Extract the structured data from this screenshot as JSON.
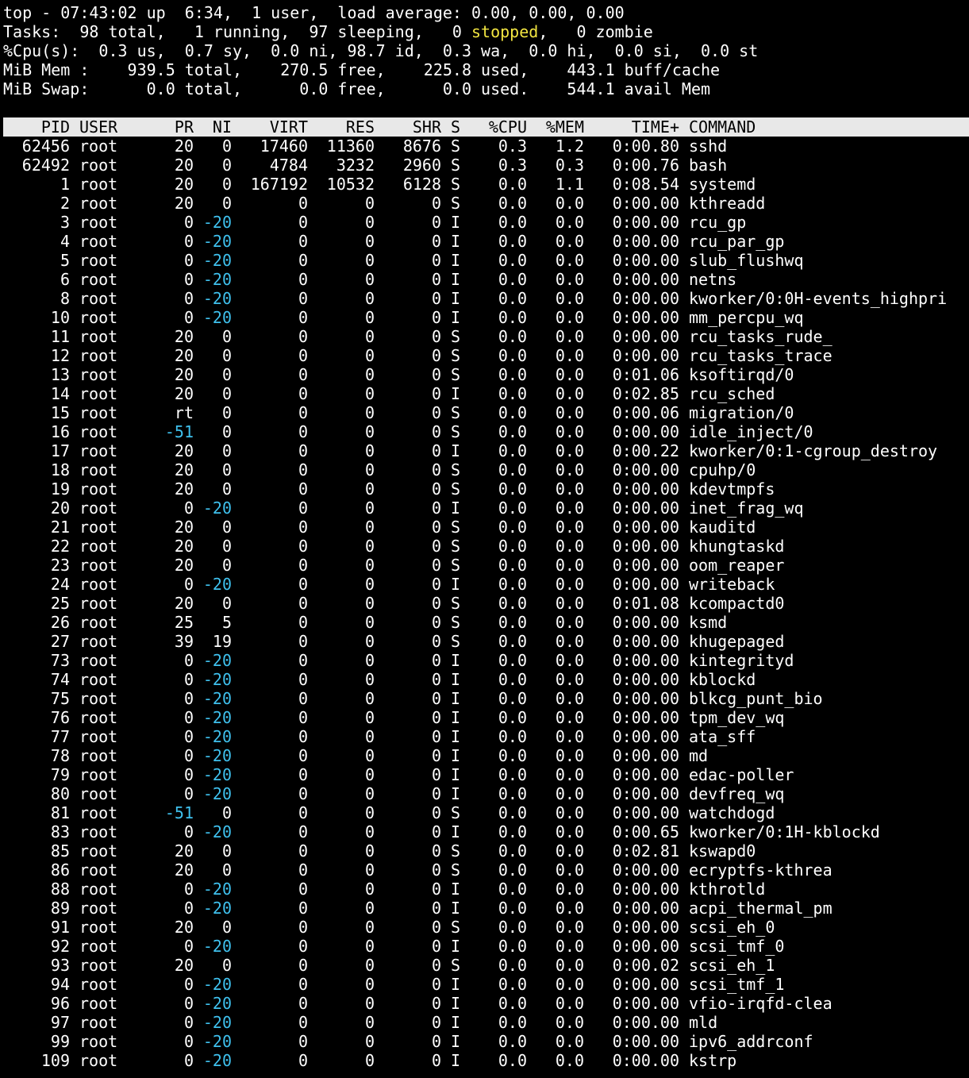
{
  "summary": {
    "line1": "top - 07:43:02 up  6:34,  1 user,  load average: 0.00, 0.00, 0.00",
    "tasks_pre": "Tasks:  98 total,   1 running,  97 sleeping,   0 ",
    "tasks_stopped": "stopped",
    "tasks_post": ",   0 zombie",
    "cpu": "%Cpu(s):  0.3 us,  0.7 sy,  0.0 ni, 98.7 id,  0.3 wa,  0.0 hi,  0.0 si,  0.0 st",
    "mem": "MiB Mem :    939.5 total,    270.5 free,    225.8 used,    443.1 buff/cache",
    "swap": "MiB Swap:      0.0 total,      0.0 free,      0.0 used.    544.1 avail Mem"
  },
  "columns": [
    "PID",
    "USER",
    "PR",
    "NI",
    "VIRT",
    "RES",
    "SHR",
    "S",
    "%CPU",
    "%MEM",
    "TIME+",
    "COMMAND"
  ],
  "processes": [
    [
      "62456",
      "root",
      "20",
      "0",
      "17460",
      "11360",
      "8676",
      "S",
      "0.3",
      "1.2",
      "0:00.80",
      "sshd"
    ],
    [
      "62492",
      "root",
      "20",
      "0",
      "4784",
      "3232",
      "2960",
      "S",
      "0.3",
      "0.3",
      "0:00.76",
      "bash"
    ],
    [
      "1",
      "root",
      "20",
      "0",
      "167192",
      "10532",
      "6128",
      "S",
      "0.0",
      "1.1",
      "0:08.54",
      "systemd"
    ],
    [
      "2",
      "root",
      "20",
      "0",
      "0",
      "0",
      "0",
      "S",
      "0.0",
      "0.0",
      "0:00.00",
      "kthreadd"
    ],
    [
      "3",
      "root",
      "0",
      "-20",
      "0",
      "0",
      "0",
      "I",
      "0.0",
      "0.0",
      "0:00.00",
      "rcu_gp"
    ],
    [
      "4",
      "root",
      "0",
      "-20",
      "0",
      "0",
      "0",
      "I",
      "0.0",
      "0.0",
      "0:00.00",
      "rcu_par_gp"
    ],
    [
      "5",
      "root",
      "0",
      "-20",
      "0",
      "0",
      "0",
      "I",
      "0.0",
      "0.0",
      "0:00.00",
      "slub_flushwq"
    ],
    [
      "6",
      "root",
      "0",
      "-20",
      "0",
      "0",
      "0",
      "I",
      "0.0",
      "0.0",
      "0:00.00",
      "netns"
    ],
    [
      "8",
      "root",
      "0",
      "-20",
      "0",
      "0",
      "0",
      "I",
      "0.0",
      "0.0",
      "0:00.00",
      "kworker/0:0H-events_highpri"
    ],
    [
      "10",
      "root",
      "0",
      "-20",
      "0",
      "0",
      "0",
      "I",
      "0.0",
      "0.0",
      "0:00.00",
      "mm_percpu_wq"
    ],
    [
      "11",
      "root",
      "20",
      "0",
      "0",
      "0",
      "0",
      "S",
      "0.0",
      "0.0",
      "0:00.00",
      "rcu_tasks_rude_"
    ],
    [
      "12",
      "root",
      "20",
      "0",
      "0",
      "0",
      "0",
      "S",
      "0.0",
      "0.0",
      "0:00.00",
      "rcu_tasks_trace"
    ],
    [
      "13",
      "root",
      "20",
      "0",
      "0",
      "0",
      "0",
      "S",
      "0.0",
      "0.0",
      "0:01.06",
      "ksoftirqd/0"
    ],
    [
      "14",
      "root",
      "20",
      "0",
      "0",
      "0",
      "0",
      "I",
      "0.0",
      "0.0",
      "0:02.85",
      "rcu_sched"
    ],
    [
      "15",
      "root",
      "rt",
      "0",
      "0",
      "0",
      "0",
      "S",
      "0.0",
      "0.0",
      "0:00.06",
      "migration/0"
    ],
    [
      "16",
      "root",
      "-51",
      "0",
      "0",
      "0",
      "0",
      "S",
      "0.0",
      "0.0",
      "0:00.00",
      "idle_inject/0"
    ],
    [
      "17",
      "root",
      "20",
      "0",
      "0",
      "0",
      "0",
      "I",
      "0.0",
      "0.0",
      "0:00.22",
      "kworker/0:1-cgroup_destroy"
    ],
    [
      "18",
      "root",
      "20",
      "0",
      "0",
      "0",
      "0",
      "S",
      "0.0",
      "0.0",
      "0:00.00",
      "cpuhp/0"
    ],
    [
      "19",
      "root",
      "20",
      "0",
      "0",
      "0",
      "0",
      "S",
      "0.0",
      "0.0",
      "0:00.00",
      "kdevtmpfs"
    ],
    [
      "20",
      "root",
      "0",
      "-20",
      "0",
      "0",
      "0",
      "I",
      "0.0",
      "0.0",
      "0:00.00",
      "inet_frag_wq"
    ],
    [
      "21",
      "root",
      "20",
      "0",
      "0",
      "0",
      "0",
      "S",
      "0.0",
      "0.0",
      "0:00.00",
      "kauditd"
    ],
    [
      "22",
      "root",
      "20",
      "0",
      "0",
      "0",
      "0",
      "S",
      "0.0",
      "0.0",
      "0:00.00",
      "khungtaskd"
    ],
    [
      "23",
      "root",
      "20",
      "0",
      "0",
      "0",
      "0",
      "S",
      "0.0",
      "0.0",
      "0:00.00",
      "oom_reaper"
    ],
    [
      "24",
      "root",
      "0",
      "-20",
      "0",
      "0",
      "0",
      "I",
      "0.0",
      "0.0",
      "0:00.00",
      "writeback"
    ],
    [
      "25",
      "root",
      "20",
      "0",
      "0",
      "0",
      "0",
      "S",
      "0.0",
      "0.0",
      "0:01.08",
      "kcompactd0"
    ],
    [
      "26",
      "root",
      "25",
      "5",
      "0",
      "0",
      "0",
      "S",
      "0.0",
      "0.0",
      "0:00.00",
      "ksmd"
    ],
    [
      "27",
      "root",
      "39",
      "19",
      "0",
      "0",
      "0",
      "S",
      "0.0",
      "0.0",
      "0:00.00",
      "khugepaged"
    ],
    [
      "73",
      "root",
      "0",
      "-20",
      "0",
      "0",
      "0",
      "I",
      "0.0",
      "0.0",
      "0:00.00",
      "kintegrityd"
    ],
    [
      "74",
      "root",
      "0",
      "-20",
      "0",
      "0",
      "0",
      "I",
      "0.0",
      "0.0",
      "0:00.00",
      "kblockd"
    ],
    [
      "75",
      "root",
      "0",
      "-20",
      "0",
      "0",
      "0",
      "I",
      "0.0",
      "0.0",
      "0:00.00",
      "blkcg_punt_bio"
    ],
    [
      "76",
      "root",
      "0",
      "-20",
      "0",
      "0",
      "0",
      "I",
      "0.0",
      "0.0",
      "0:00.00",
      "tpm_dev_wq"
    ],
    [
      "77",
      "root",
      "0",
      "-20",
      "0",
      "0",
      "0",
      "I",
      "0.0",
      "0.0",
      "0:00.00",
      "ata_sff"
    ],
    [
      "78",
      "root",
      "0",
      "-20",
      "0",
      "0",
      "0",
      "I",
      "0.0",
      "0.0",
      "0:00.00",
      "md"
    ],
    [
      "79",
      "root",
      "0",
      "-20",
      "0",
      "0",
      "0",
      "I",
      "0.0",
      "0.0",
      "0:00.00",
      "edac-poller"
    ],
    [
      "80",
      "root",
      "0",
      "-20",
      "0",
      "0",
      "0",
      "I",
      "0.0",
      "0.0",
      "0:00.00",
      "devfreq_wq"
    ],
    [
      "81",
      "root",
      "-51",
      "0",
      "0",
      "0",
      "0",
      "S",
      "0.0",
      "0.0",
      "0:00.00",
      "watchdogd"
    ],
    [
      "83",
      "root",
      "0",
      "-20",
      "0",
      "0",
      "0",
      "I",
      "0.0",
      "0.0",
      "0:00.65",
      "kworker/0:1H-kblockd"
    ],
    [
      "85",
      "root",
      "20",
      "0",
      "0",
      "0",
      "0",
      "S",
      "0.0",
      "0.0",
      "0:02.81",
      "kswapd0"
    ],
    [
      "86",
      "root",
      "20",
      "0",
      "0",
      "0",
      "0",
      "S",
      "0.0",
      "0.0",
      "0:00.00",
      "ecryptfs-kthrea"
    ],
    [
      "88",
      "root",
      "0",
      "-20",
      "0",
      "0",
      "0",
      "I",
      "0.0",
      "0.0",
      "0:00.00",
      "kthrotld"
    ],
    [
      "89",
      "root",
      "0",
      "-20",
      "0",
      "0",
      "0",
      "I",
      "0.0",
      "0.0",
      "0:00.00",
      "acpi_thermal_pm"
    ],
    [
      "91",
      "root",
      "20",
      "0",
      "0",
      "0",
      "0",
      "S",
      "0.0",
      "0.0",
      "0:00.00",
      "scsi_eh_0"
    ],
    [
      "92",
      "root",
      "0",
      "-20",
      "0",
      "0",
      "0",
      "I",
      "0.0",
      "0.0",
      "0:00.00",
      "scsi_tmf_0"
    ],
    [
      "93",
      "root",
      "20",
      "0",
      "0",
      "0",
      "0",
      "S",
      "0.0",
      "0.0",
      "0:00.02",
      "scsi_eh_1"
    ],
    [
      "94",
      "root",
      "0",
      "-20",
      "0",
      "0",
      "0",
      "I",
      "0.0",
      "0.0",
      "0:00.00",
      "scsi_tmf_1"
    ],
    [
      "96",
      "root",
      "0",
      "-20",
      "0",
      "0",
      "0",
      "I",
      "0.0",
      "0.0",
      "0:00.00",
      "vfio-irqfd-clea"
    ],
    [
      "97",
      "root",
      "0",
      "-20",
      "0",
      "0",
      "0",
      "I",
      "0.0",
      "0.0",
      "0:00.00",
      "mld"
    ],
    [
      "99",
      "root",
      "0",
      "-20",
      "0",
      "0",
      "0",
      "I",
      "0.0",
      "0.0",
      "0:00.00",
      "ipv6_addrconf"
    ],
    [
      "109",
      "root",
      "0",
      "-20",
      "0",
      "0",
      "0",
      "I",
      "0.0",
      "0.0",
      "0:00.00",
      "kstrp"
    ]
  ],
  "colors": {
    "background": "#000000",
    "foreground": "#ffffff",
    "header_bg": "#e8e8e8",
    "header_fg": "#000000",
    "negative_priority": "#3fc1ee",
    "stopped": "#f2e541"
  }
}
